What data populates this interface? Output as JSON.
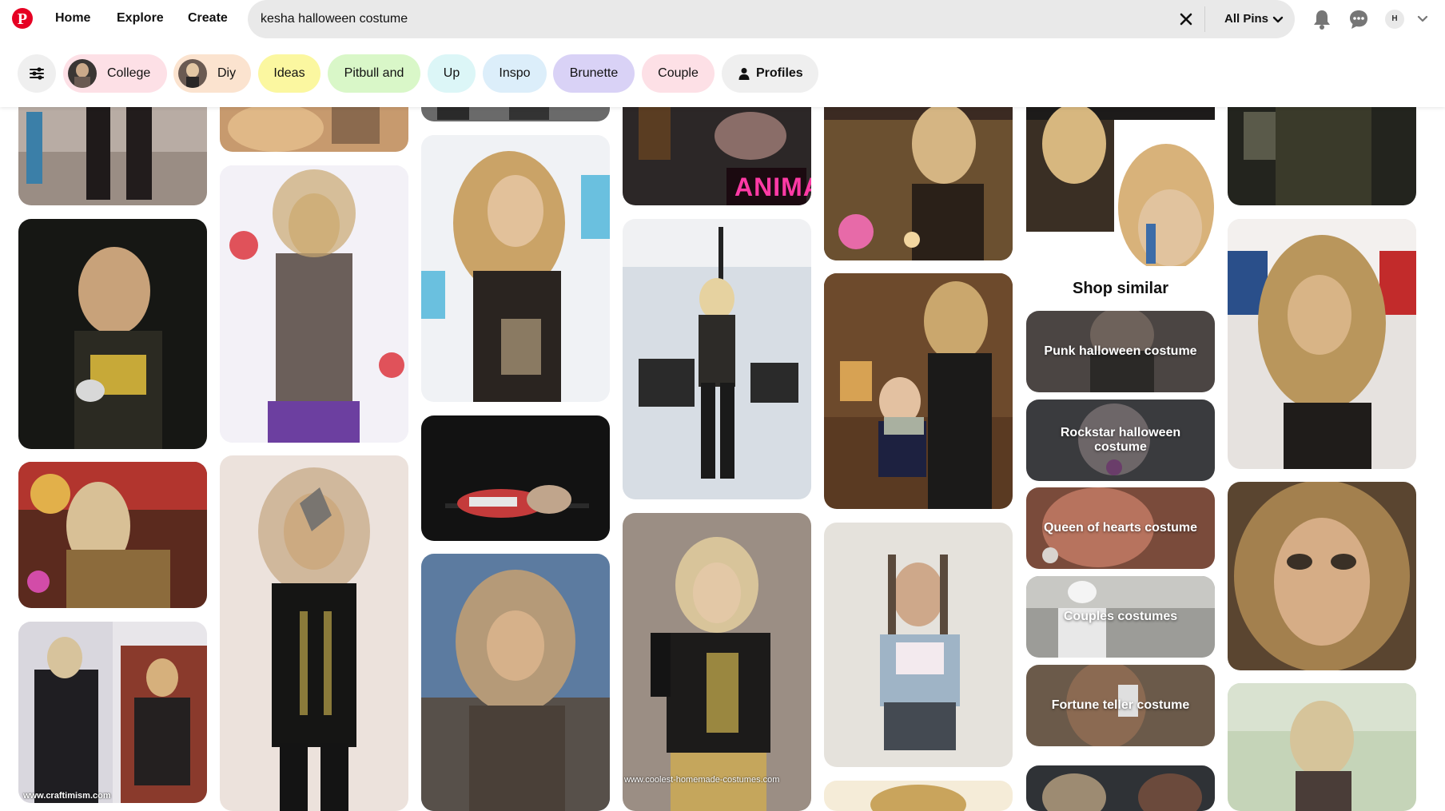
{
  "nav": {
    "home": "Home",
    "explore": "Explore",
    "create": "Create"
  },
  "search": {
    "value": "kesha halloween costume",
    "scope": "All Pins"
  },
  "account": {
    "initial": "H"
  },
  "chips": [
    {
      "label": "College",
      "color": "#fde0e6"
    },
    {
      "label": "Diy",
      "color": "#fbe3cf"
    },
    {
      "label": "Ideas",
      "color": "#fbf7a0"
    },
    {
      "label": "Pitbull and",
      "color": "#d9f7c8"
    },
    {
      "label": "Up",
      "color": "#dcf6f7"
    },
    {
      "label": "Inspo",
      "color": "#dceefa"
    },
    {
      "label": "Brunette",
      "color": "#d9d2f6"
    },
    {
      "label": "Couple",
      "color": "#fde0e6"
    },
    {
      "label": "Profiles",
      "color": "#efefef"
    }
  ],
  "shop": {
    "title": "Shop similar",
    "items": [
      {
        "label": "Punk halloween costume"
      },
      {
        "label": "Rockstar halloween costume"
      },
      {
        "label": "Queen of hearts costume"
      },
      {
        "label": "Couples costumes"
      },
      {
        "label": "Fortune teller costume"
      }
    ]
  },
  "watermarks": {
    "craftimism": "www.craftimism.com",
    "coolest": "www.coolest-homemade-costumes.com",
    "animal": "ANIMAL"
  },
  "colors": {
    "brand": "#e60023",
    "searchBg": "#e9e9e9"
  },
  "icons": [
    "pinterest-logo-icon",
    "close-icon",
    "chevron-down-icon",
    "bell-icon",
    "chat-icon",
    "filter-icon",
    "person-icon"
  ]
}
